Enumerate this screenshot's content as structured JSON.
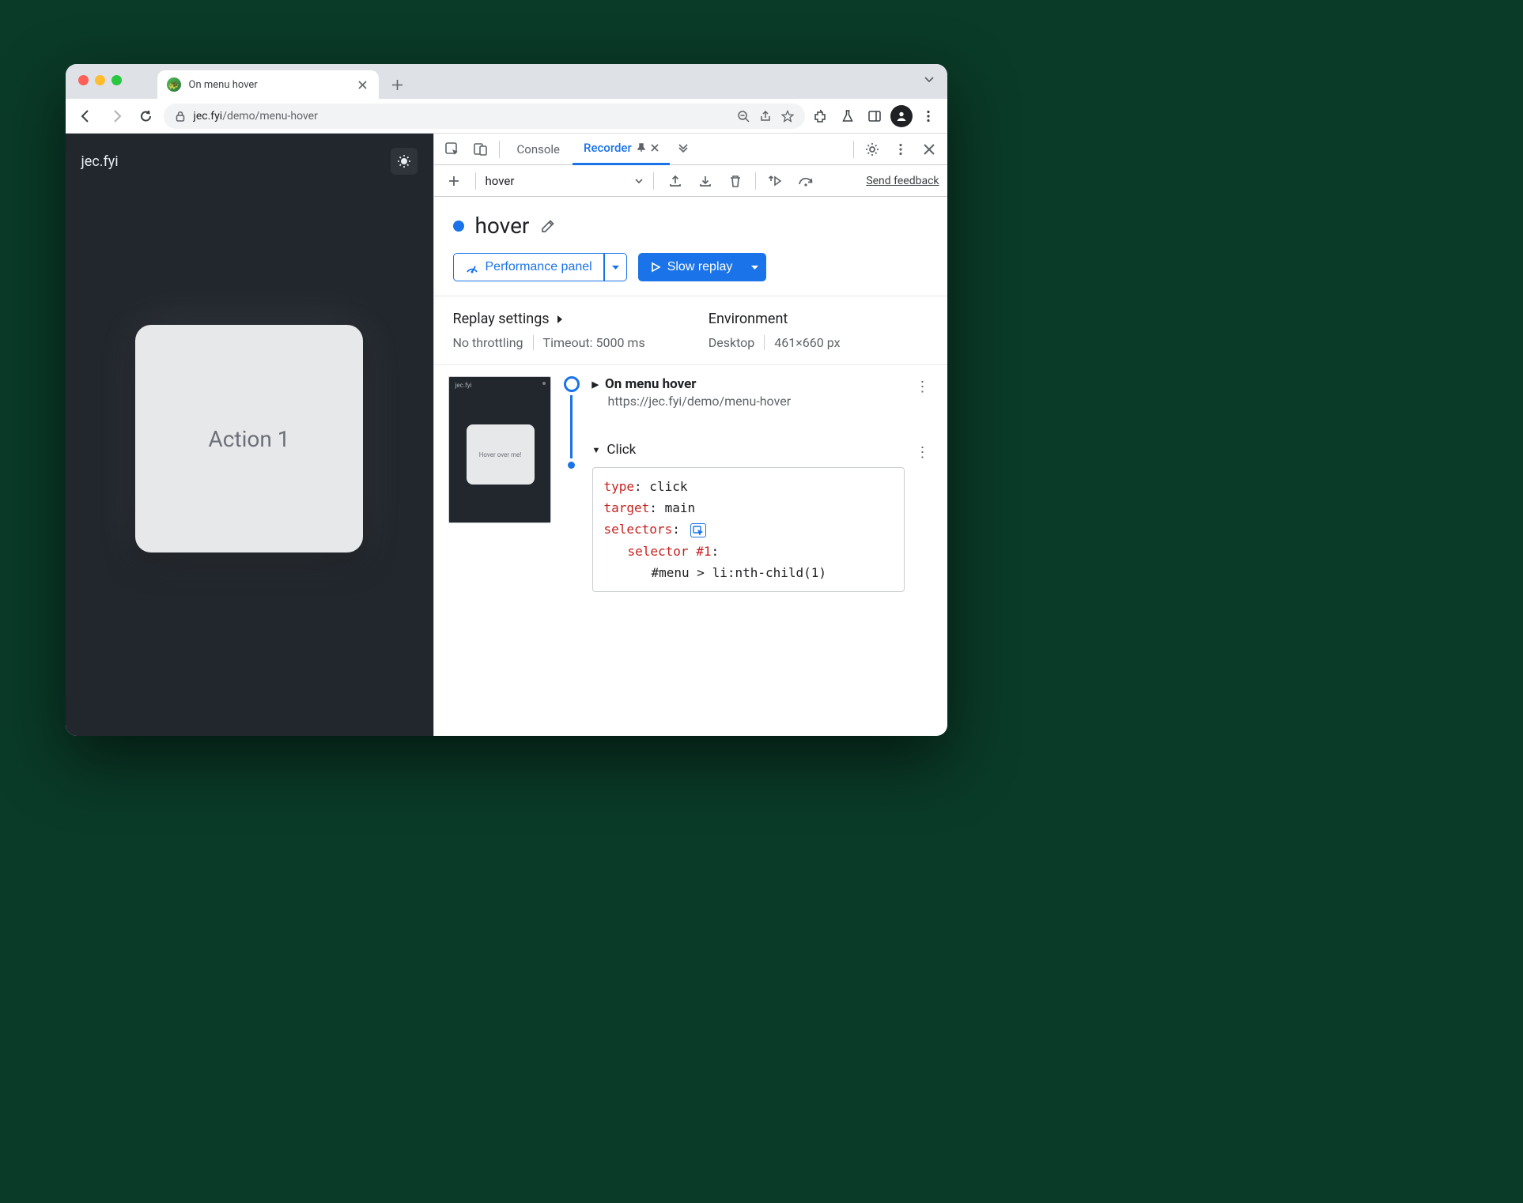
{
  "browser": {
    "tab_title": "On menu hover",
    "url_domain": "jec.fyi",
    "url_path": "/demo/menu-hover"
  },
  "page": {
    "site_name": "jec.fyi",
    "card_text": "Action 1"
  },
  "devtools": {
    "tabs": {
      "console": "Console",
      "recorder": "Recorder"
    },
    "recording_name": "hover",
    "feedback": "Send feedback",
    "title": "hover",
    "perf_btn": "Performance panel",
    "replay_btn": "Slow replay",
    "settings": {
      "replay_label": "Replay settings",
      "throttle": "No throttling",
      "timeout": "Timeout: 5000 ms",
      "env_label": "Environment",
      "env_device": "Desktop",
      "env_size": "461×660 px"
    },
    "thumb_text": "Hover over me!",
    "step_nav": {
      "title": "On menu hover",
      "url": "https://jec.fyi/demo/menu-hover"
    },
    "step_click": {
      "title": "Click",
      "code": {
        "type_k": "type",
        "type_v": "click",
        "target_k": "target",
        "target_v": "main",
        "selectors_k": "selectors",
        "selector_label": "selector #1",
        "selector_val": "#menu > li:nth-child(1)"
      }
    }
  }
}
